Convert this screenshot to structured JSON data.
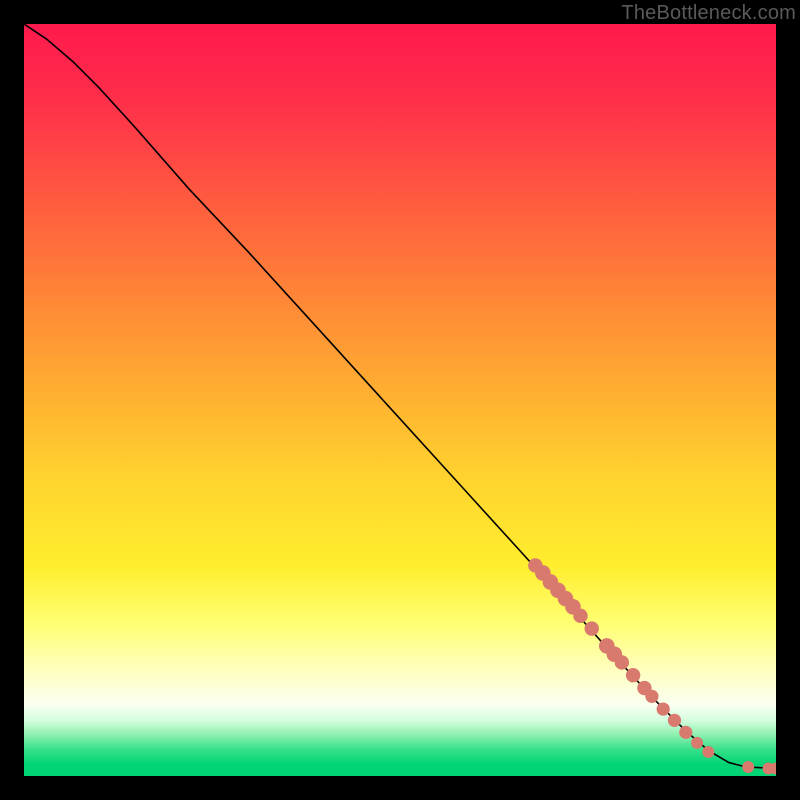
{
  "attribution": "TheBottleneck.com",
  "chart_data": {
    "type": "line",
    "title": "",
    "xlabel": "",
    "ylabel": "",
    "xlim": [
      0,
      100
    ],
    "ylim": [
      0,
      100
    ],
    "gradient_stops": [
      {
        "offset": 0.0,
        "color": "#ff1a4d"
      },
      {
        "offset": 0.1,
        "color": "#ff2e4a"
      },
      {
        "offset": 0.28,
        "color": "#ff6a3c"
      },
      {
        "offset": 0.45,
        "color": "#ffa233"
      },
      {
        "offset": 0.6,
        "color": "#ffd22e"
      },
      {
        "offset": 0.72,
        "color": "#ffee2e"
      },
      {
        "offset": 0.8,
        "color": "#ffff76"
      },
      {
        "offset": 0.86,
        "color": "#ffffc0"
      },
      {
        "offset": 0.905,
        "color": "#fafff0"
      },
      {
        "offset": 0.925,
        "color": "#d6ffe0"
      },
      {
        "offset": 0.945,
        "color": "#8ff0b0"
      },
      {
        "offset": 0.965,
        "color": "#36e08a"
      },
      {
        "offset": 0.985,
        "color": "#00d474"
      },
      {
        "offset": 1.0,
        "color": "#00d474"
      }
    ],
    "curve": [
      {
        "x": 0.0,
        "y": 100.0
      },
      {
        "x": 3.0,
        "y": 98.0
      },
      {
        "x": 6.5,
        "y": 95.0
      },
      {
        "x": 10.0,
        "y": 91.5
      },
      {
        "x": 15.0,
        "y": 86.0
      },
      {
        "x": 22.0,
        "y": 78.0
      },
      {
        "x": 30.0,
        "y": 69.5
      },
      {
        "x": 40.0,
        "y": 58.5
      },
      {
        "x": 50.0,
        "y": 47.5
      },
      {
        "x": 60.0,
        "y": 36.5
      },
      {
        "x": 70.0,
        "y": 25.5
      },
      {
        "x": 78.0,
        "y": 16.5
      },
      {
        "x": 84.0,
        "y": 10.0
      },
      {
        "x": 88.0,
        "y": 6.0
      },
      {
        "x": 91.0,
        "y": 3.4
      },
      {
        "x": 93.7,
        "y": 1.8
      },
      {
        "x": 96.0,
        "y": 1.2
      },
      {
        "x": 100.0,
        "y": 1.0
      }
    ],
    "scatter": [
      {
        "x": 68.0,
        "y": 28.0,
        "r": 1.2
      },
      {
        "x": 69.0,
        "y": 27.0,
        "r": 1.3
      },
      {
        "x": 70.0,
        "y": 25.8,
        "r": 1.3
      },
      {
        "x": 71.0,
        "y": 24.7,
        "r": 1.3
      },
      {
        "x": 72.0,
        "y": 23.6,
        "r": 1.3
      },
      {
        "x": 73.0,
        "y": 22.5,
        "r": 1.3
      },
      {
        "x": 74.0,
        "y": 21.3,
        "r": 1.2
      },
      {
        "x": 75.5,
        "y": 19.6,
        "r": 1.2
      },
      {
        "x": 77.5,
        "y": 17.3,
        "r": 1.3
      },
      {
        "x": 78.5,
        "y": 16.2,
        "r": 1.3
      },
      {
        "x": 79.5,
        "y": 15.1,
        "r": 1.2
      },
      {
        "x": 81.0,
        "y": 13.4,
        "r": 1.2
      },
      {
        "x": 82.5,
        "y": 11.7,
        "r": 1.2
      },
      {
        "x": 83.5,
        "y": 10.6,
        "r": 1.1
      },
      {
        "x": 85.0,
        "y": 8.9,
        "r": 1.1
      },
      {
        "x": 86.5,
        "y": 7.4,
        "r": 1.1
      },
      {
        "x": 88.0,
        "y": 5.8,
        "r": 1.1
      },
      {
        "x": 89.5,
        "y": 4.4,
        "r": 1.0
      },
      {
        "x": 91.0,
        "y": 3.2,
        "r": 1.0
      },
      {
        "x": 96.3,
        "y": 1.2,
        "r": 1.0
      },
      {
        "x": 99.0,
        "y": 1.0,
        "r": 1.0
      },
      {
        "x": 100.0,
        "y": 1.0,
        "r": 1.0
      }
    ],
    "scatter_color": "#d97a6e"
  }
}
